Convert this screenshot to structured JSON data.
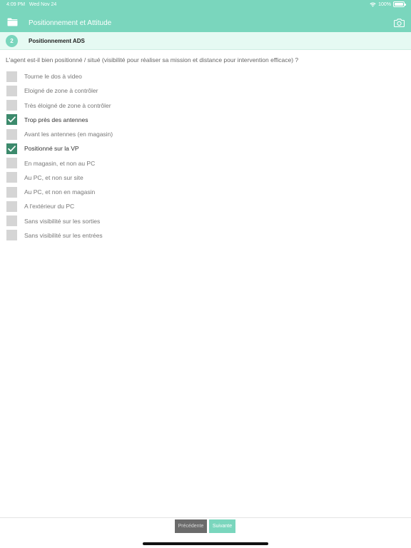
{
  "status_bar": {
    "time": "4:09 PM",
    "date": "Wed Nov 24",
    "battery": "100%"
  },
  "header": {
    "title": "Positionnement et Attitude",
    "left_icon": "folder-icon",
    "right_icon": "camera-icon"
  },
  "section": {
    "step": "2",
    "title": "Positionnement ADS"
  },
  "question": "L'agent est-il bien positionné / situé (visibilité pour réaliser sa mission et distance pour intervention efficace) ?",
  "options": [
    {
      "label": "Tourne le dos à video",
      "checked": false
    },
    {
      "label": "Eloigné de zone à contrôler",
      "checked": false
    },
    {
      "label": "Très éloigné de zone à contrôler",
      "checked": false
    },
    {
      "label": "Trop près des antennes",
      "checked": true
    },
    {
      "label": "Avant les antennes (en magasin)",
      "checked": false
    },
    {
      "label": "Positionné sur la VP",
      "checked": true
    },
    {
      "label": "En magasin, et non au PC",
      "checked": false
    },
    {
      "label": "Au PC, et non sur site",
      "checked": false
    },
    {
      "label": "Au PC, et non en magasin",
      "checked": false
    },
    {
      "label": "A l'extérieur du PC",
      "checked": false
    },
    {
      "label": "Sans visibilité sur les sorties",
      "checked": false
    },
    {
      "label": "Sans visibilité sur les entrées",
      "checked": false
    }
  ],
  "footer": {
    "prev_label": "Précédente",
    "next_label": "Suivante"
  },
  "colors": {
    "accent": "#7ad6bd",
    "checked": "#3c8a6c",
    "unchecked": "#d5d5d5"
  }
}
